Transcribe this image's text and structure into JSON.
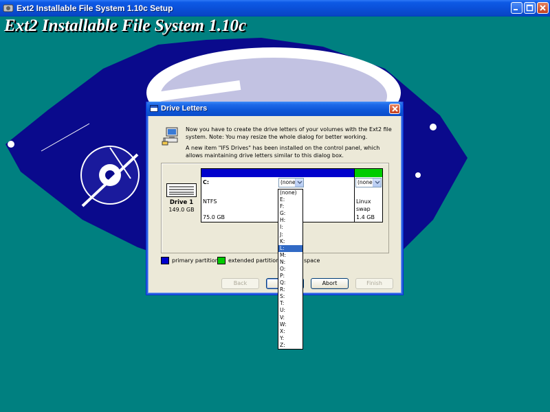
{
  "window": {
    "title": "Ext2 Installable File System 1.10c Setup",
    "hero_title": "Ext2 Installable File System 1.10c"
  },
  "dialog": {
    "title": "Drive Letters",
    "paragraph1": "Now you have to create the drive letters of your volumes with the Ext2 file system. Note: You may resize the whole dialog for better working.",
    "paragraph2": "A new item \"IFS Drives\" has been installed on the control panel, which allows maintaining drive letters similar to this dialog box.",
    "drive": {
      "name": "Drive 1",
      "size": "149.0 GB"
    },
    "partitions": [
      {
        "letter": "C:",
        "combo_value": "(none)",
        "fs": "NTFS",
        "size": "75.0 GB",
        "type": "primary"
      },
      {
        "letter": "",
        "combo_value": "(none)",
        "fs": "Linux swap",
        "fs_line1": "Linux",
        "fs_line2": "swap",
        "size": "1.4 GB",
        "type": "extended"
      }
    ],
    "legend": {
      "primary": "primary partition",
      "extended": "extended partition",
      "free_partial": "space"
    },
    "buttons": {
      "back": "Back",
      "next": "",
      "abort": "Abort",
      "finish": "Finish"
    },
    "dropdown": {
      "selected": "L:",
      "options": [
        "(none)",
        "E:",
        "F:",
        "G:",
        "H:",
        "I:",
        "J:",
        "K:",
        "L:",
        "M:",
        "N:",
        "O:",
        "P:",
        "Q:",
        "R:",
        "S:",
        "T:",
        "U:",
        "V:",
        "W:",
        "X:",
        "Y:",
        "Z:"
      ]
    }
  },
  "colors": {
    "desktop": "#008080",
    "art": "#0a0a8c",
    "primary_partition": "#0000cc",
    "extended_partition": "#00cc00",
    "selection": "#316ac5"
  }
}
